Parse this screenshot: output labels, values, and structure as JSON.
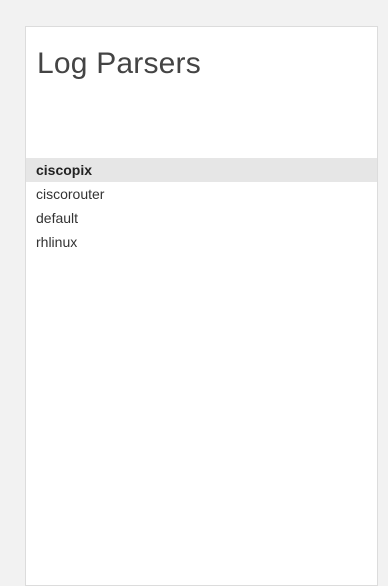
{
  "panel": {
    "title": "Log Parsers"
  },
  "parsers": {
    "items": [
      {
        "label": "ciscopix",
        "selected": true
      },
      {
        "label": "ciscorouter",
        "selected": false
      },
      {
        "label": "default",
        "selected": false
      },
      {
        "label": "rhlinux",
        "selected": false
      }
    ]
  },
  "colors": {
    "selected_background": "#e6e6e6",
    "panel_border": "#dcdcdc",
    "page_background": "#f2f2f2"
  }
}
